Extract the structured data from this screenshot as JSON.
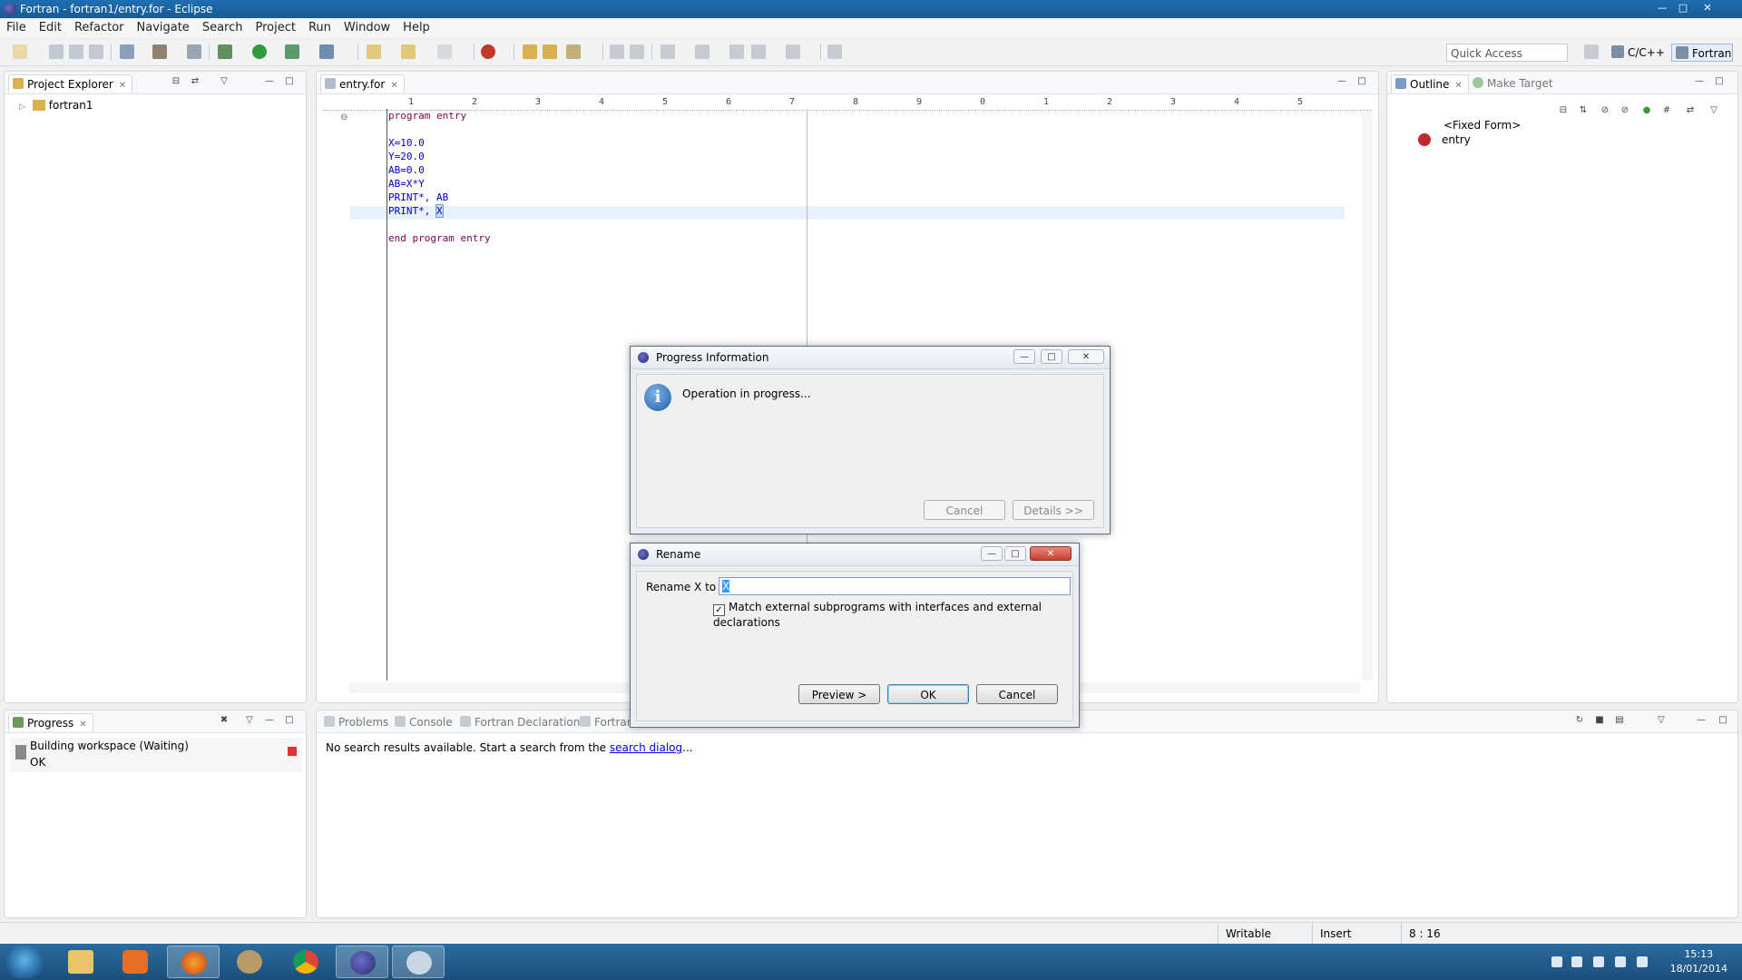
{
  "window": {
    "title": "Fortran - fortran1/entry.for - Eclipse"
  },
  "menu": [
    "File",
    "Edit",
    "Refactor",
    "Navigate",
    "Search",
    "Project",
    "Run",
    "Window",
    "Help"
  ],
  "toolbar": {
    "quick_access": "Quick Access",
    "perspectives": [
      "C/C++",
      "Fortran"
    ]
  },
  "project_explorer": {
    "title": "Project Explorer",
    "tree": [
      {
        "label": "fortran1"
      }
    ]
  },
  "editor": {
    "tab": "entry.for",
    "ruler": [
      "1",
      "2",
      "3",
      "4",
      "5",
      "6",
      "7",
      "8",
      "9",
      "0",
      "1",
      "2",
      "3",
      "4",
      "5"
    ],
    "lines": [
      "program entry",
      "",
      "X=10.0",
      "Y=20.0",
      "AB=0.0",
      "AB=X*Y",
      "PRINT*, AB",
      "PRINT*, X",
      "",
      "end program entry"
    ]
  },
  "outline": {
    "title": "Outline",
    "other_tab": "Make Target",
    "items": [
      "<Fixed Form>",
      "entry"
    ]
  },
  "progress_view": {
    "title": "Progress",
    "job": "Building workspace (Waiting)",
    "status": "OK"
  },
  "bottom_tabs": [
    "Problems",
    "Console",
    "Fortran Declaration",
    "Fortran"
  ],
  "search_view": {
    "message_prefix": "No search results available. Start a search from the ",
    "link": "search dialog",
    "suffix": "..."
  },
  "progress_dialog": {
    "title": "Progress Information",
    "message": "Operation in progress...",
    "cancel": "Cancel",
    "details": "Details >>"
  },
  "rename_dialog": {
    "title": "Rename",
    "label": "Rename X to",
    "value": "X",
    "checkbox": "Match external subprograms with interfaces and external declarations",
    "checked": true,
    "preview": "Preview >",
    "ok": "OK",
    "cancel": "Cancel"
  },
  "statusbar": {
    "writable": "Writable",
    "mode": "Insert",
    "position": "8 : 16"
  },
  "taskbar": {
    "time": "15:13",
    "date": "18/01/2014"
  }
}
